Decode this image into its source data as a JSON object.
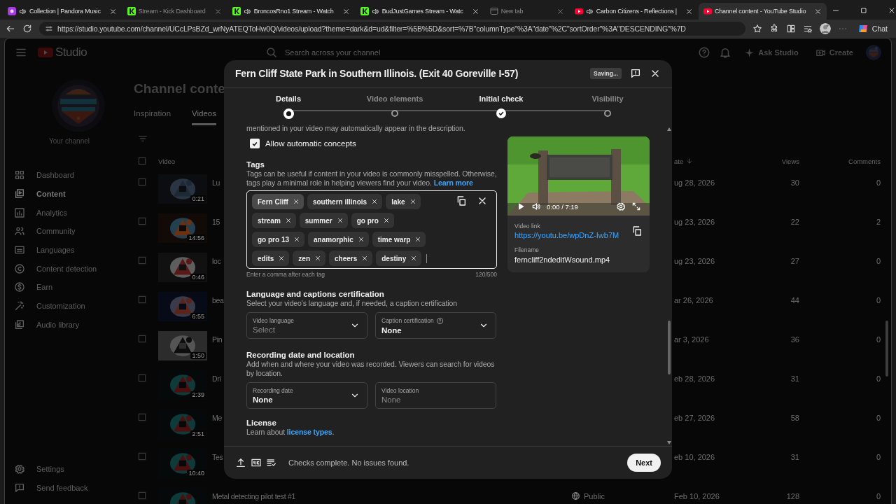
{
  "browser": {
    "tabs": [
      {
        "title": "Collection | Pandora Music",
        "kind": "pandora",
        "audio": true,
        "sleeping": false,
        "selected": false
      },
      {
        "title": "Stream - Kick Dashboard",
        "kind": "kick",
        "audio": false,
        "sleeping": true,
        "selected": false
      },
      {
        "title": "BroncosRno1 Stream - Watch",
        "kind": "kick",
        "audio": true,
        "sleeping": false,
        "selected": false
      },
      {
        "title": "BudJustGames Stream - Watc",
        "kind": "kick",
        "audio": true,
        "sleeping": false,
        "selected": false
      },
      {
        "title": "New tab",
        "kind": "newtab",
        "audio": false,
        "sleeping": true,
        "selected": false
      },
      {
        "title": "Carbon Citizens - Reflections |",
        "kind": "youtube",
        "audio": true,
        "sleeping": false,
        "selected": false
      },
      {
        "title": "Channel content - YouTube Studio",
        "kind": "youtube",
        "audio": false,
        "sleeping": false,
        "selected": true
      }
    ],
    "url": "https://studio.youtube.com/channel/UCcLPsBZd_wrNyATEQToHw0Q/videos/upload?theme=dark&d=ud&filter=%5B%5D&sort=%7B\"columnType\"%3A\"date\"%2C\"sortOrder\"%3A\"DESCENDING\"%7D",
    "chat": "Chat"
  },
  "studio": {
    "logo": "Studio",
    "search_placeholder": "Search across your channel",
    "ask": "Ask Studio",
    "create": "Create"
  },
  "sidebar": {
    "channel_label": "Your channel",
    "items": [
      {
        "label": "Dashboard",
        "selected": false
      },
      {
        "label": "Content",
        "selected": true
      },
      {
        "label": "Analytics",
        "selected": false
      },
      {
        "label": "Community",
        "selected": false
      },
      {
        "label": "Languages",
        "selected": false
      },
      {
        "label": "Content detection",
        "selected": false
      },
      {
        "label": "Earn",
        "selected": false
      },
      {
        "label": "Customization",
        "selected": false
      },
      {
        "label": "Audio library",
        "selected": false
      }
    ],
    "footer_items": [
      "Settings",
      "Send feedback"
    ]
  },
  "content": {
    "title": "Channel conte",
    "tabs": [
      {
        "label": "Inspiration",
        "selected": false
      },
      {
        "label": "Videos",
        "selected": true
      }
    ],
    "table": {
      "columns": [
        "Video",
        "ate",
        "Views",
        "Comments"
      ],
      "all_selected": false,
      "rows": [
        {
          "duration": "0:21",
          "title": "Lu",
          "date": "ug 28, 2026",
          "views": "30",
          "comments": "0",
          "selected": false
        },
        {
          "duration": "14:56",
          "title": "15",
          "date": "ug 23, 2026",
          "views": "22",
          "comments": "2",
          "selected": false
        },
        {
          "duration": "0:46",
          "title": "loc",
          "date": "ug 23, 2026",
          "views": "27",
          "comments": "0",
          "selected": false
        },
        {
          "duration": "6:55",
          "title": "bea",
          "date": "ar 26, 2026",
          "views": "44",
          "comments": "0",
          "selected": false
        },
        {
          "duration": "1:50",
          "title": "Pin",
          "date": "ar 3, 2026",
          "views": "36",
          "comments": "0",
          "selected": false
        },
        {
          "duration": "2:39",
          "title": "Dri",
          "date": "eb 28, 2026",
          "views": "31",
          "comments": "0",
          "selected": false
        },
        {
          "duration": "2:51",
          "title": "Me",
          "date": "eb 27, 2026",
          "views": "58",
          "comments": "0",
          "selected": false
        },
        {
          "duration": "10:40",
          "title": "Tes",
          "date": "eb 10, 2026",
          "views": "31",
          "comments": "0",
          "selected": false
        },
        {
          "title": "Metal detecting pilot test #1",
          "visibility": "Public",
          "date": "Feb 10, 2026",
          "views": "128",
          "comments": "0",
          "selected": false
        }
      ]
    }
  },
  "dialog": {
    "title": "Fern Cliff State Park in Southern Illinois. (Exit 40 Goreville I-57)",
    "status": "Saving...",
    "steps": [
      {
        "label": "Details",
        "selected": true,
        "done": false
      },
      {
        "label": "Video elements",
        "selected": false,
        "done": false
      },
      {
        "label": "Initial check",
        "selected": false,
        "done": true
      },
      {
        "label": "Visibility",
        "selected": false,
        "done": false
      }
    ],
    "concepts_note": "mentioned in your video may automatically appear in the description.",
    "auto_concepts": {
      "label": "Allow automatic concepts",
      "checked": true
    },
    "tags": {
      "heading": "Tags",
      "description": "Tags can be useful if content in your video is commonly misspelled. Otherwise, tags play a minimal role in helping viewers find your video.",
      "link": "Learn more",
      "chips": [
        {
          "label": "Fern Cliff",
          "selected": true
        },
        {
          "label": "southern illinois",
          "selected": false
        },
        {
          "label": "lake",
          "selected": false
        },
        {
          "label": "stream",
          "selected": false
        },
        {
          "label": "summer",
          "selected": false
        },
        {
          "label": "go pro",
          "selected": false
        },
        {
          "label": "go pro 13",
          "selected": false
        },
        {
          "label": "anamorphic",
          "selected": false
        },
        {
          "label": "time warp",
          "selected": false
        },
        {
          "label": "edits",
          "selected": false
        },
        {
          "label": "zen",
          "selected": false
        },
        {
          "label": "cheers",
          "selected": false
        },
        {
          "label": "destiny",
          "selected": false
        }
      ],
      "hint": "Enter a comma after each tag",
      "counter": "120/500"
    },
    "language": {
      "heading": "Language and captions certification",
      "description": "Select your video's language and, if needed, a caption certification",
      "fields": [
        {
          "kind": "select",
          "label": "Video language",
          "placeholder": "Select"
        },
        {
          "kind": "select",
          "label": "Caption certification",
          "help_icon": true,
          "value": "None"
        }
      ]
    },
    "recording": {
      "heading": "Recording date and location",
      "description": "Add when and where your video was recorded. Viewers can search for videos by location.",
      "fields": [
        {
          "kind": "select",
          "label": "Recording date",
          "value": "None"
        },
        {
          "kind": "input",
          "label": "Video location",
          "placeholder": "None"
        }
      ]
    },
    "license": {
      "heading": "License",
      "text_before": "Learn about ",
      "link": "license types",
      "text_after": "."
    },
    "preview": {
      "time": "0:00 / 7:19",
      "link_label": "Video link",
      "link": "https://youtu.be/wpDnZ-Iwb7M",
      "filename_label": "Filename",
      "filename": "ferncliff2ndeditWsound.mp4"
    },
    "footer": {
      "status": "Checks complete. No issues found.",
      "next": "Next"
    }
  }
}
